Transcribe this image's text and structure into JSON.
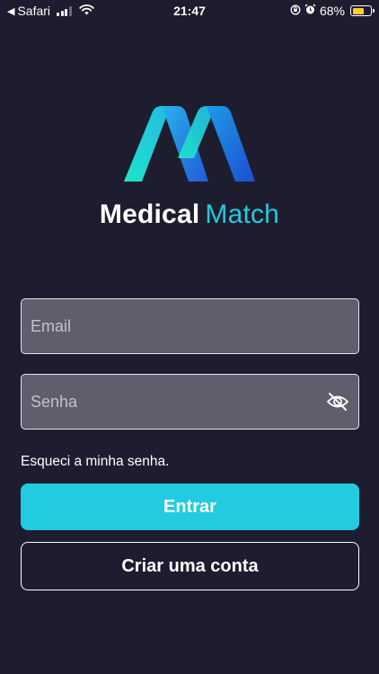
{
  "status_bar": {
    "back_app": "Safari",
    "time": "21:47",
    "battery_percent": "68%",
    "battery_level": 0.68,
    "battery_color": "#f7d02c"
  },
  "brand": {
    "name_bold": "Medical",
    "name_light": "Match",
    "accent_color": "#24c9de"
  },
  "form": {
    "email_placeholder": "Email",
    "email_value": "",
    "password_placeholder": "Senha",
    "password_value": "",
    "forgot_link": "Esqueci a minha senha."
  },
  "actions": {
    "login_label": "Entrar",
    "signup_label": "Criar uma conta"
  },
  "colors": {
    "background": "#1d1d2f",
    "input_bg": "#5e5e6d",
    "primary": "#23cbe0"
  },
  "icons": {
    "logo": "medical-match-logo",
    "password_toggle": "eye-slash-icon"
  }
}
